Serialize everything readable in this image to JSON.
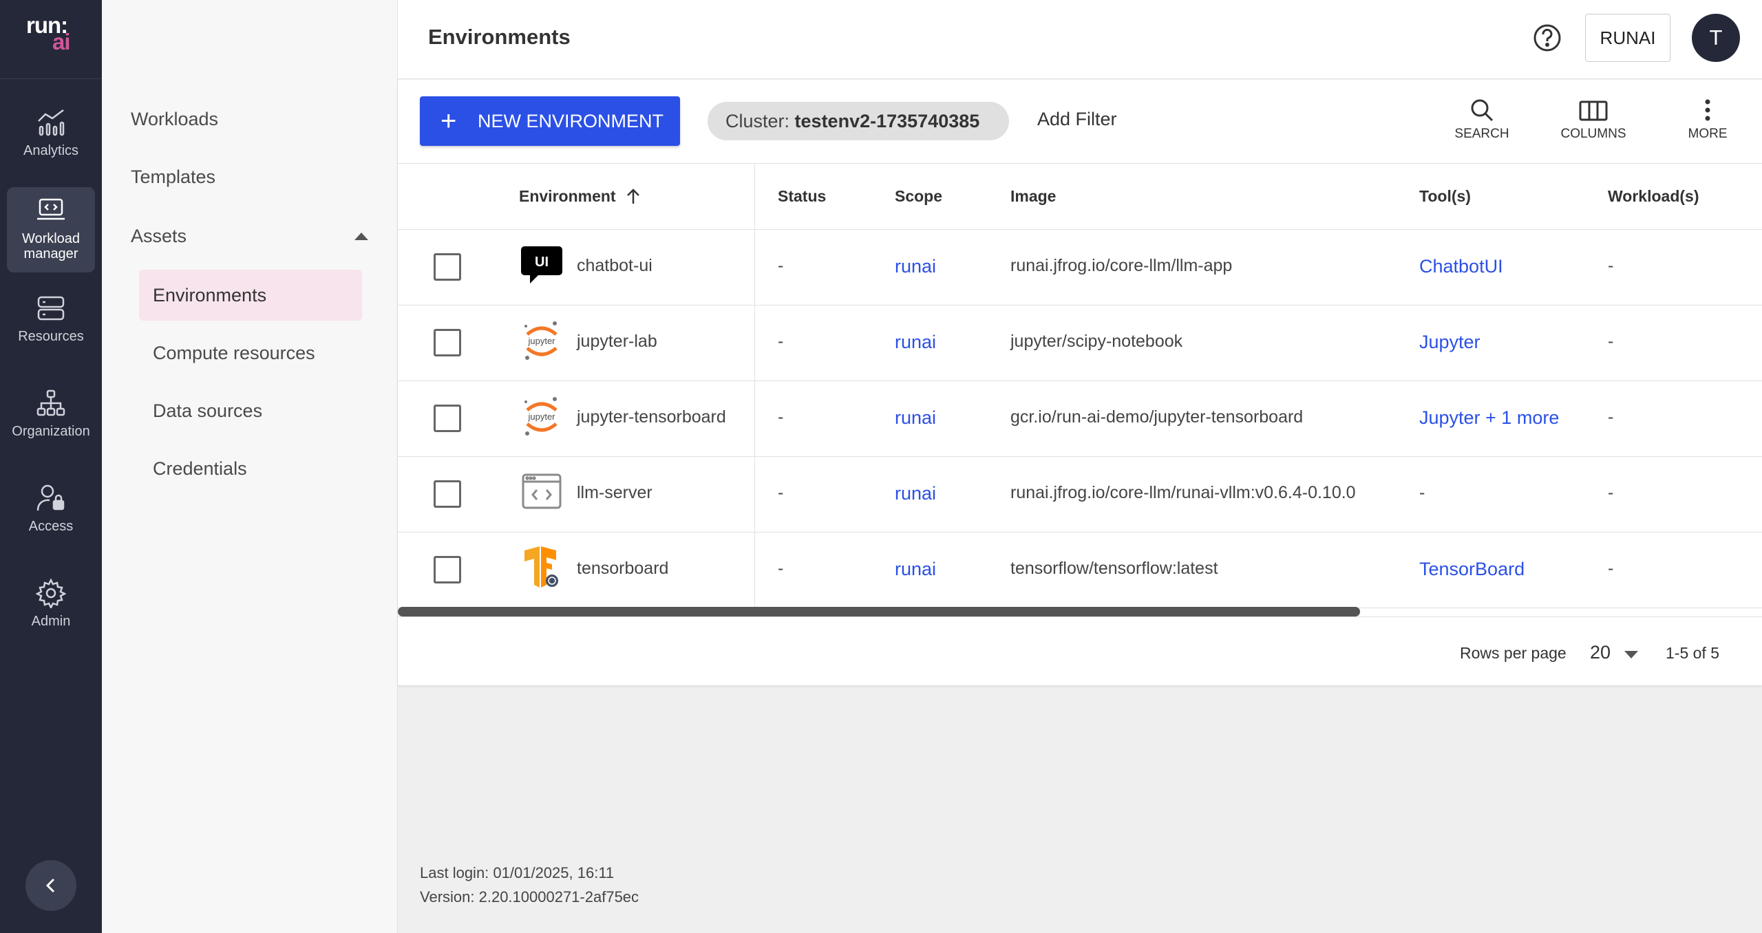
{
  "logo": {
    "line1": "run:",
    "line2": "ai"
  },
  "rail": [
    {
      "label": "Analytics",
      "icon": "analytics-icon"
    },
    {
      "label": "Workload manager",
      "icon": "workload-manager-icon"
    },
    {
      "label": "Resources",
      "icon": "resources-icon"
    },
    {
      "label": "Organization",
      "icon": "organization-icon"
    },
    {
      "label": "Access",
      "icon": "access-icon"
    },
    {
      "label": "Admin",
      "icon": "gear-icon"
    }
  ],
  "subnav": {
    "workloads": "Workloads",
    "templates": "Templates",
    "assets": "Assets",
    "environments": "Environments",
    "compute": "Compute resources",
    "data": "Data sources",
    "credentials": "Credentials"
  },
  "header": {
    "title": "Environments",
    "tenant": "RUNAI",
    "avatar": "T"
  },
  "toolbar": {
    "new_button": "NEW ENVIRONMENT",
    "chip_key": "Cluster:",
    "chip_value": "testenv2-1735740385",
    "add_filter": "Add Filter",
    "search": "SEARCH",
    "columns": "COLUMNS",
    "more": "MORE"
  },
  "table": {
    "headers": {
      "environment": "Environment",
      "status": "Status",
      "scope": "Scope",
      "image": "Image",
      "tools": "Tool(s)",
      "workloads": "Workload(s)"
    },
    "rows": [
      {
        "name": "chatbot-ui",
        "status": "-",
        "scope": "runai",
        "image": "runai.jfrog.io/core-llm/llm-app",
        "tools": "ChatbotUI",
        "workloads": "-"
      },
      {
        "name": "jupyter-lab",
        "status": "-",
        "scope": "runai",
        "image": "jupyter/scipy-notebook",
        "tools": "Jupyter",
        "workloads": "-"
      },
      {
        "name": "jupyter-tensorboard",
        "status": "-",
        "scope": "runai",
        "image": "gcr.io/run-ai-demo/jupyter-tensorboard",
        "tools": "Jupyter + 1 more",
        "workloads": "-"
      },
      {
        "name": "llm-server",
        "status": "-",
        "scope": "runai",
        "image": "runai.jfrog.io/core-llm/runai-vllm:v0.6.4-0.10.0",
        "tools": "-",
        "workloads": "-"
      },
      {
        "name": "tensorboard",
        "status": "-",
        "scope": "runai",
        "image": "tensorflow/tensorflow:latest",
        "tools": "TensorBoard",
        "workloads": "-"
      }
    ],
    "icon_text": {
      "chatbot": "UI",
      "jupyter": "jupyter"
    }
  },
  "pagination": {
    "rows_label": "Rows per page",
    "rows_value": "20",
    "range": "1-5 of 5"
  },
  "footer": {
    "last_login": "Last login: 01/01/2025, 16:11",
    "version": "Version: 2.20.10000271-2af75ec"
  },
  "colors": {
    "accent": "#2b50e6",
    "rail": "#242838",
    "active_sub": "#f7e4ec",
    "logo_ai": "#d0569b"
  }
}
